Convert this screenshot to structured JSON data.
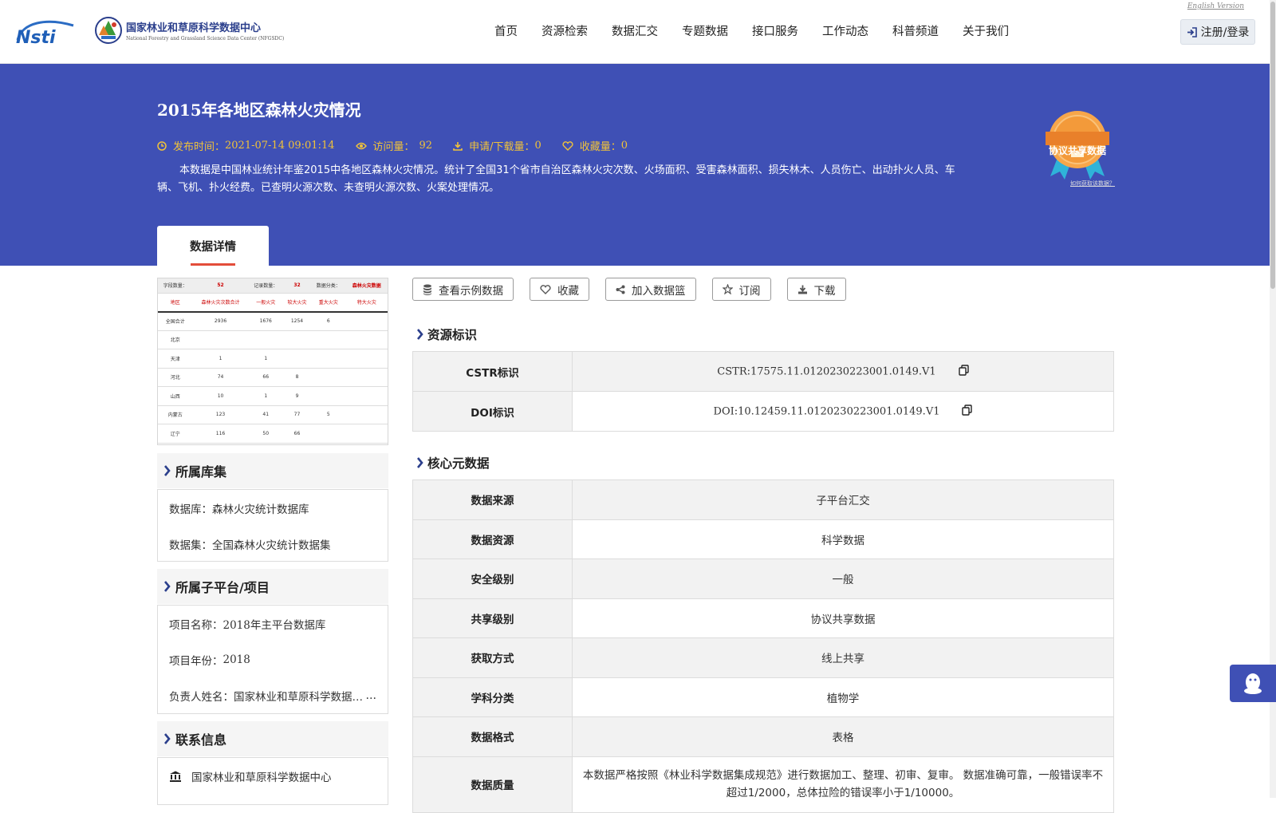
{
  "header": {
    "logo_text": "NSTI",
    "org_name_cn": "国家林业和草原科学数据中心",
    "org_name_en": "National Forestry and Grassland Science Data Center (NFGSDC)",
    "english_link": "English Version",
    "nav": [
      "首页",
      "资源检索",
      "数据汇交",
      "专题数据",
      "接口服务",
      "工作动态",
      "科普频道",
      "关于我们"
    ],
    "login_label": "注册/登录"
  },
  "dataset": {
    "title": "2015年各地区森林火灾情况",
    "publish_label": "发布时间：",
    "publish_time": "2021-07-14 09:01:14",
    "visits_label": "访问量：",
    "visits": "92",
    "downloads_label": "申请/下载量：",
    "downloads": "0",
    "favorites_label": "收藏量：",
    "favorites": "0",
    "description": "本数据是中国林业统计年鉴2015中各地区森林火灾情况。统计了全国31个省市自治区森林火灾次数、火场面积、受害森林面积、损失林木、人员伤亡、出动扑火人员、车辆、飞机、扑火经费。已查明火源次数、未查明火源次数、火案处理情况。",
    "badge_text": "协议共享数据",
    "badge_link": "如何获取该数据？",
    "tab_label": "数据详情"
  },
  "preview": {
    "header": [
      "字段数量：",
      "52",
      "记录数量：",
      "32",
      "数据分类：",
      "森林火灾数据"
    ],
    "columns": [
      "地区",
      "森林火灾次数合计",
      "一般火灾",
      "较大火灾",
      "重大火灾",
      "特大火灾"
    ],
    "rows": [
      [
        "全国合计",
        "2936",
        "1676",
        "1254",
        "6",
        ""
      ],
      [
        "北京",
        "",
        "",
        "",
        "",
        ""
      ],
      [
        "天津",
        "1",
        "1",
        "",
        "",
        ""
      ],
      [
        "河北",
        "74",
        "66",
        "8",
        "",
        ""
      ],
      [
        "山西",
        "10",
        "1",
        "9",
        "",
        ""
      ],
      [
        "内蒙古",
        "123",
        "41",
        "77",
        "5",
        ""
      ],
      [
        "辽宁",
        "116",
        "50",
        "66",
        "",
        ""
      ]
    ]
  },
  "sidebar": {
    "library_title": "所属库集",
    "database_label": "数据库：",
    "database": "森林火灾统计数据库",
    "dataset_label": "数据集：",
    "dataset": "全国森林火灾统计数据集",
    "project_title": "所属子平台/项目",
    "project_name_label": "项目名称：",
    "project_name": "2018年主平台数据库",
    "project_year_label": "项目年份：",
    "project_year": "2018",
    "owner_label": "负责人姓名：",
    "owner": "国家林业和草原科学数据中心",
    "contact_title": "联系信息",
    "contact_org": "国家林业和草原科学数据中心"
  },
  "actions": [
    "查看示例数据",
    "收藏",
    "加入数据篮",
    "订阅",
    "下载"
  ],
  "resource_id": {
    "title": "资源标识",
    "rows": [
      {
        "k": "CSTR标识",
        "v": "CSTR:17575.11.0120230223001.0149.V1"
      },
      {
        "k": "DOI标识",
        "v": "DOI:10.12459.11.0120230223001.0149.V1"
      }
    ]
  },
  "core_meta": {
    "title": "核心元数据",
    "rows": [
      {
        "k": "数据来源",
        "v": "子平台汇交"
      },
      {
        "k": "数据资源",
        "v": "科学数据"
      },
      {
        "k": "安全级别",
        "v": "一般"
      },
      {
        "k": "共享级别",
        "v": "协议共享数据"
      },
      {
        "k": "获取方式",
        "v": "线上共享"
      },
      {
        "k": "学科分类",
        "v": "植物学"
      },
      {
        "k": "数据格式",
        "v": "表格"
      },
      {
        "k": "数据质量",
        "v": "本数据严格按照《林业科学数据集成规范》进行数据加工、整理、初审、复审。 数据准确可靠，一般错误率不超过1/2000，总体拉险的错误率小于1/10000。"
      }
    ]
  },
  "colors": {
    "banner": "#3f50b5",
    "meta": "#f0c23a",
    "accent": "#e34d3a"
  }
}
